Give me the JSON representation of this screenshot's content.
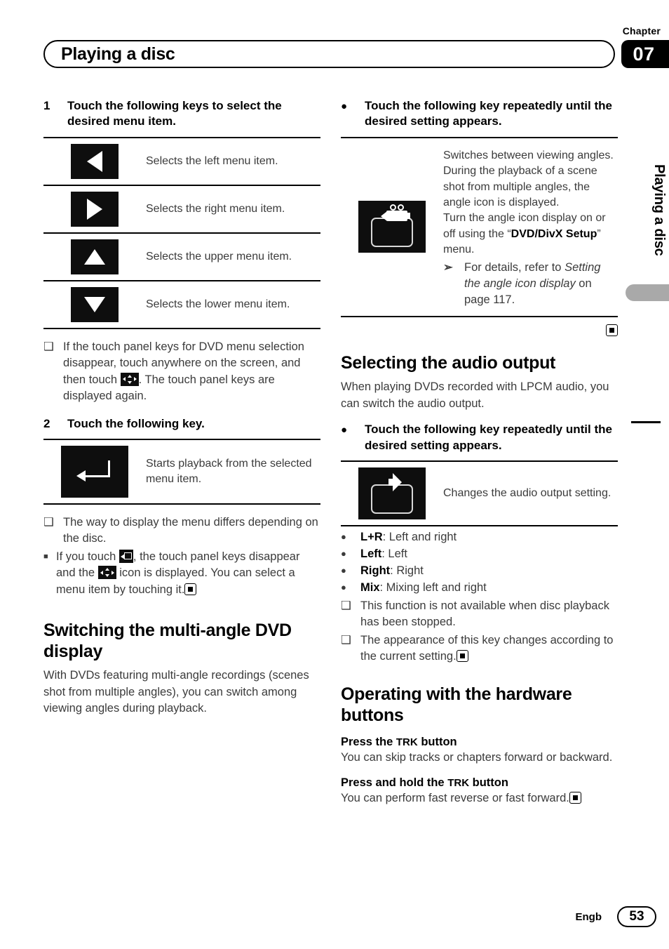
{
  "header": {
    "chapter_label": "Chapter",
    "chapter_number": "07",
    "title": "Playing a disc"
  },
  "left_column": {
    "step1": {
      "number": "1",
      "text": "Touch the following keys to select the desired menu item."
    },
    "nav_keys": [
      {
        "icon": "triangle-left-icon",
        "desc": "Selects the left menu item."
      },
      {
        "icon": "triangle-right-icon",
        "desc": "Selects the right menu item."
      },
      {
        "icon": "triangle-up-icon",
        "desc": "Selects the upper menu item."
      },
      {
        "icon": "triangle-down-icon",
        "desc": "Selects the lower menu item."
      }
    ],
    "note1_a": "If the touch panel keys for DVD menu selection disappear, touch anywhere on the screen, and then touch",
    "note1_b": ". The touch panel keys are displayed again.",
    "step2": {
      "number": "2",
      "text": "Touch the following key."
    },
    "enter_key": {
      "icon": "return-arrow-icon",
      "desc": "Starts playback from the selected menu item."
    },
    "note2": "The way to display the menu differs depending on the disc.",
    "note3_a": "If you touch",
    "note3_b": ", the touch panel keys disappear and the",
    "note3_c": "icon is displayed. You can select a menu item by touching it.",
    "section_multi_angle": {
      "heading": "Switching the multi-angle DVD display",
      "body": "With DVDs featuring multi-angle recordings (scenes shot from multiple angles), you can switch among viewing angles during playback."
    }
  },
  "right_column": {
    "bullet1": "Touch the following key repeatedly until the desired setting appears.",
    "angle_key": {
      "icon": "movie-camera-angle-icon",
      "desc_line1": "Switches between viewing angles. During the playback of a scene shot from multiple angles, the angle icon is displayed.",
      "desc_line2_a": "Turn the angle icon display on or off using the “",
      "desc_line2_bold": "DVD/DivX Setup",
      "desc_line2_b": "” menu.",
      "ref_prefix": "For details, refer to",
      "ref_italic": "Setting the angle icon display",
      "ref_suffix": "on page 117."
    },
    "section_audio": {
      "heading": "Selecting the audio output",
      "body": "When playing DVDs recorded with LPCM audio, you can switch the audio output.",
      "bullet": "Touch the following key repeatedly until the desired setting appears.",
      "audio_key": {
        "icon": "speaker-audio-icon",
        "desc": "Changes the audio output setting."
      },
      "options": [
        {
          "name": "L+R",
          "desc": ": Left and right"
        },
        {
          "name": "Left",
          "desc": ": Left"
        },
        {
          "name": "Right",
          "desc": ": Right"
        },
        {
          "name": "Mix",
          "desc": ": Mixing left and right"
        }
      ],
      "note1": "This function is not available when disc playback has been stopped.",
      "note2": "The appearance of this key changes according to the current setting."
    },
    "section_hardware": {
      "heading": "Operating with the hardware buttons",
      "sub1_a": "Press the",
      "sub1_trk": "TRK",
      "sub1_b": "button",
      "body1": "You can skip tracks or chapters forward or backward.",
      "sub2_a": "Press and hold the",
      "sub2_trk": "TRK",
      "sub2_b": "button",
      "body2": "You can perform fast reverse or fast forward."
    }
  },
  "side_tab": {
    "text": "Playing a disc"
  },
  "footer": {
    "language": "Engb",
    "page_number": "53"
  }
}
